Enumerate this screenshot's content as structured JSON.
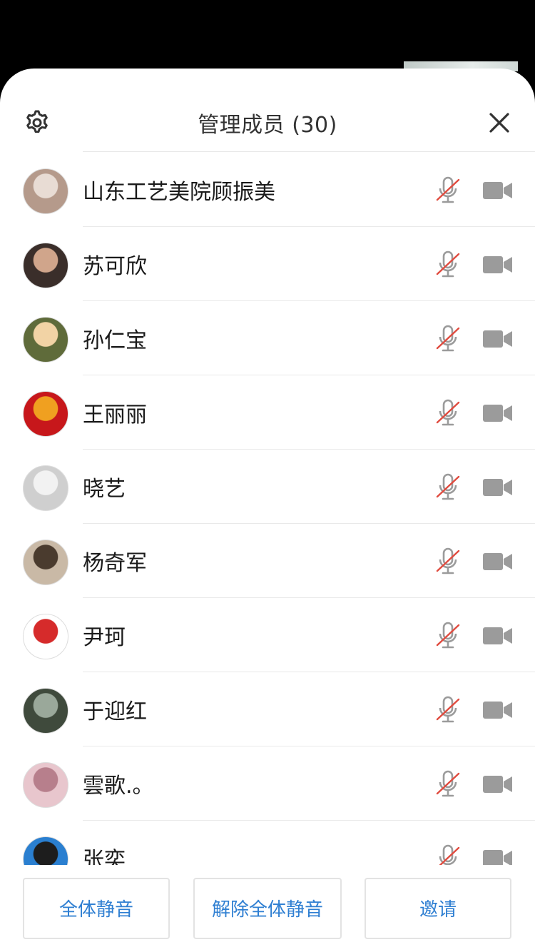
{
  "header": {
    "title": "管理成员 (30)"
  },
  "members": [
    {
      "name": "山东工艺美院顾振美",
      "avatar_colors": [
        "#b59a8b",
        "#e8dcd4"
      ],
      "mic": "muted",
      "camera": "off"
    },
    {
      "name": "苏可欣",
      "avatar_colors": [
        "#3a2e2a",
        "#d0a58b"
      ],
      "mic": "muted",
      "camera": "off"
    },
    {
      "name": "孙仁宝",
      "avatar_colors": [
        "#5f6b3a",
        "#f2d3a5"
      ],
      "mic": "muted",
      "camera": "off"
    },
    {
      "name": "王丽丽",
      "avatar_colors": [
        "#c7171b",
        "#f0a020"
      ],
      "mic": "muted",
      "camera": "off"
    },
    {
      "name": "晓艺",
      "avatar_colors": [
        "#cfcfcf",
        "#f2f2f2"
      ],
      "mic": "muted",
      "camera": "off"
    },
    {
      "name": "杨奇军",
      "avatar_colors": [
        "#c9b9a6",
        "#4a3b2e"
      ],
      "mic": "muted",
      "camera": "off"
    },
    {
      "name": "尹珂",
      "avatar_colors": [
        "#ffffff",
        "#d62b2b"
      ],
      "mic": "muted",
      "camera": "off"
    },
    {
      "name": "于迎红",
      "avatar_colors": [
        "#3f4a3c",
        "#9aa89a"
      ],
      "mic": "muted",
      "camera": "off"
    },
    {
      "name": "雲歌.。",
      "avatar_colors": [
        "#e8c6cd",
        "#b77f8c"
      ],
      "mic": "muted",
      "camera": "off"
    },
    {
      "name": "张奕",
      "avatar_colors": [
        "#2a7fd0",
        "#1d1d1d"
      ],
      "mic": "muted",
      "camera": "off"
    }
  ],
  "actions": {
    "mute_all": "全体静音",
    "unmute_all": "解除全体静音",
    "invite": "邀请"
  },
  "colors": {
    "accent": "#2f7fd2",
    "muted_slash": "#e04b3f",
    "icon_gray": "#9b9b9b"
  }
}
